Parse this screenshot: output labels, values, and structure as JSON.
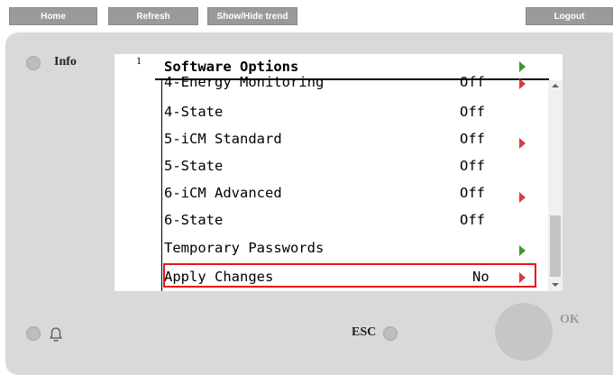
{
  "toolbar": {
    "home": "Home",
    "refresh": "Refresh",
    "trend": "Show/Hide trend",
    "logout": "Logout"
  },
  "panel": {
    "info_label": "Info",
    "esc_label": "ESC",
    "ok_label": "OK"
  },
  "screen": {
    "page_number": "1",
    "title": "Software Options",
    "rows": [
      {
        "name": "4-Energy Monitoring",
        "value": "Off"
      },
      {
        "name": "4-State",
        "value": "Off"
      },
      {
        "name": "5-iCM Standard",
        "value": "Off"
      },
      {
        "name": "5-State",
        "value": "Off"
      },
      {
        "name": "6-iCM Advanced",
        "value": "Off"
      },
      {
        "name": "6-State",
        "value": "Off"
      },
      {
        "name": "Temporary Passwords",
        "value": ""
      },
      {
        "name": "Apply Changes",
        "value": "No"
      }
    ]
  },
  "colors": {
    "arrow_red": "#e0393b",
    "arrow_green": "#3b9a2a",
    "highlight": "#e8141b",
    "toolbar_button": "#9a9a9a"
  },
  "icons": {
    "bell": "bell-icon",
    "arrow": "triangle-right"
  }
}
